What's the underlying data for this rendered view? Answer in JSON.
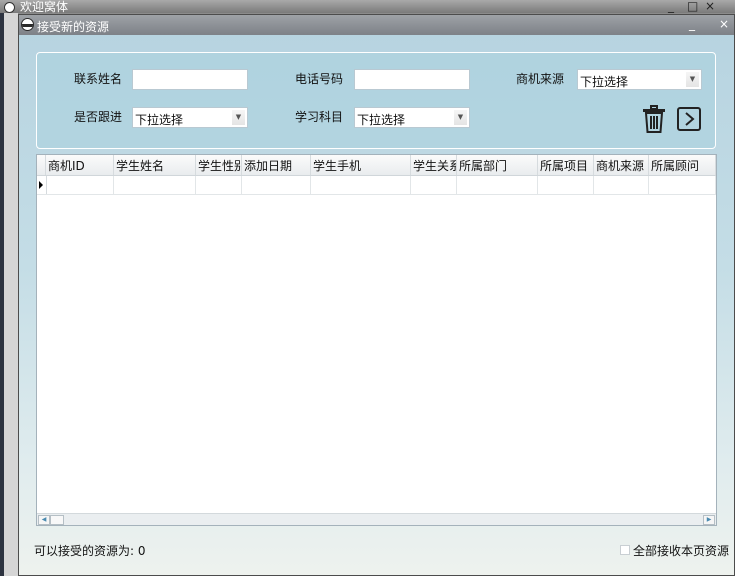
{
  "background_window": {
    "title": "欢迎窝体"
  },
  "window": {
    "title": "接受新的资源",
    "controls": {
      "minimize": "_",
      "maximize": "□",
      "close": "×"
    }
  },
  "filters": {
    "contact_name": {
      "label": "联系姓名",
      "value": ""
    },
    "phone": {
      "label": "电话号码",
      "value": ""
    },
    "source": {
      "label": "商机来源",
      "value": "下拉选择"
    },
    "follow_up": {
      "label": "是否跟进",
      "value": "下拉选择"
    },
    "subject": {
      "label": "学习科目",
      "value": "下拉选择"
    }
  },
  "icons": {
    "delete": "trash-icon",
    "next": "chevron-right-icon"
  },
  "grid": {
    "columns": [
      "商机ID",
      "学生姓名",
      "学生性别",
      "添加日期",
      "学生手机",
      "学生关系",
      "所属部门",
      "所属项目",
      "商机来源",
      "所属顾问"
    ],
    "rows": [
      [
        "",
        "",
        "",
        "",
        "",
        "",
        "",
        "",
        "",
        ""
      ]
    ]
  },
  "status": {
    "label": "可以接受的资源为:",
    "count": "0",
    "text": "可以接受的资源为: 0"
  },
  "accept_all": {
    "label": "全部接收本页资源",
    "checked": false
  }
}
